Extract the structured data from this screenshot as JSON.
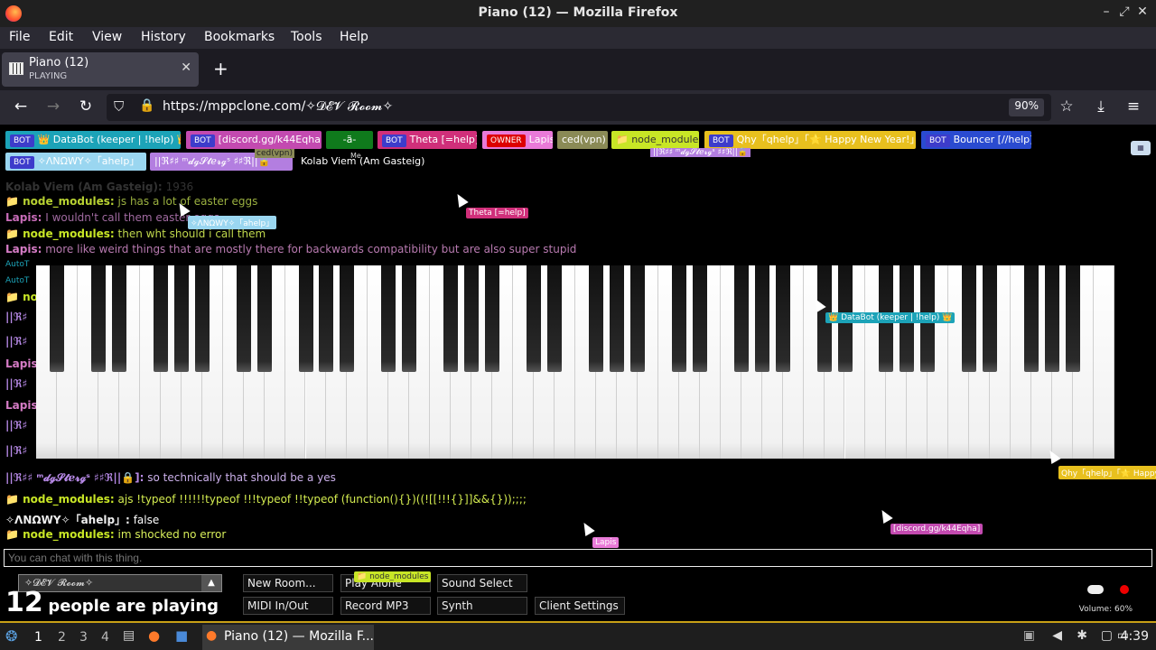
{
  "browser": {
    "window_title": "Piano (12) — Mozilla Firefox",
    "menu": [
      "File",
      "Edit",
      "View",
      "History",
      "Bookmarks",
      "Tools",
      "Help"
    ],
    "tab": {
      "title": "Piano (12)",
      "subtitle": "PLAYING"
    },
    "url": "https://mppclone.com/✧𝓓𝓔𝓥 𝓡𝓸𝓸𝓶✧",
    "zoom": "90%"
  },
  "users": [
    {
      "badge": "BOT",
      "name": "👑 DataBot (keeper | !help) 👑",
      "color": "#1ca3b8",
      "text": "#fff"
    },
    {
      "badge": "BOT",
      "name": "[discord.gg/k44Eqha]",
      "color": "#c34ab0",
      "text": "#fff"
    },
    {
      "badge": "",
      "name": "-ä-",
      "color": "#0f7a1c",
      "text": "#fff"
    },
    {
      "badge": "BOT",
      "name": "Theta [=help]",
      "color": "#d02f7a",
      "text": "#fff"
    },
    {
      "badge": "OWNER",
      "name": "Lapis",
      "color": "#e97ad8",
      "text": "#fff"
    },
    {
      "badge": "",
      "name": "ced(vpn)",
      "color": "#8a8a56",
      "text": "#fff"
    },
    {
      "badge": "",
      "name": "📁 node_modules",
      "color": "#c8e626",
      "text": "#333"
    },
    {
      "badge": "BOT",
      "name": "Qhy「qhelp」「🌟 Happy New Year!」",
      "color": "#e8c01e",
      "text": "#fff"
    },
    {
      "badge": "BOT",
      "name": "Bouncer [//help]",
      "color": "#2a4bd0",
      "text": "#fff"
    },
    {
      "badge": "BOT",
      "name": "✧ΛNΩWY✧「ahelp」",
      "color": "#9ad6f0",
      "text": "#fff"
    },
    {
      "badge": "",
      "name": "||ℜ♯♯ ᵐ𝓭ℊ𝓢𝓽ℯ𝓻ℊˢ ♯♯ℜ||🔒",
      "color": "#b37ee0",
      "text": "#fff"
    },
    {
      "badge": "",
      "name": "Kolab Viem (Am Gasteig)",
      "color": "#000000",
      "text": "#fff"
    }
  ],
  "mini_labels": {
    "ced": "ced(vpn)",
    "me": "Me",
    "mdg": "||ℜ♯♯ ᵐ𝓭ℊ𝓢𝓽ℯ𝓻ℊˢ ♯♯ℜ||🔒"
  },
  "chat": [
    {
      "name": "Kolab Viem (Am Gasteig):",
      "text": "1936",
      "name_color": "#333",
      "text_color": "#333"
    },
    {
      "name": "📁 node_modules:",
      "text": "js has a lot of easter eggs",
      "name_color": "#b8d232",
      "text_color": "#9ab040"
    },
    {
      "name": "Lapis:",
      "text": "I wouldn't call them easter eggs",
      "name_color": "#c86cb8",
      "text_color": "#a06aa0"
    },
    {
      "name": "📁 node_modules:",
      "text": "then wht should i call them",
      "name_color": "#c8e626",
      "text_color": "#c0d84c"
    },
    {
      "name": "Lapis:",
      "text": "more like weird things that are mostly there for backwards compatibility but are also super stupid",
      "name_color": "#d67cc6",
      "text_color": "#b87ab0"
    }
  ],
  "left_stubs": [
    "AutoT",
    "AutoT",
    "📁 no",
    "||ℜ♯",
    "||ℜ♯",
    "Lapis",
    "||ℜ♯",
    "Lapis",
    "||ℜ♯",
    "||ℜ♯"
  ],
  "chat_bottom": [
    {
      "name": "||ℜ♯♯ ᵐ𝓭ℊ𝓢𝓽ℯ𝓻ℊˢ ♯♯ℜ||🔒]:",
      "text": "so technically that should be a yes",
      "name_color": "#b88ae8",
      "text_color": "#cbb0ea"
    },
    {
      "name": "📁 node_modules:",
      "text": "ajs !typeof !!!!!!typeof !!!typeof !!typeof (function(){})((![[!!!{}]]&&{}));;;;",
      "name_color": "#c8e626",
      "text_color": "#d4ec50"
    },
    {
      "name": "✧ΛNΩWY✧「ahelp」:",
      "text": "false",
      "name_color": "#eee",
      "text_color": "#fff"
    },
    {
      "name": "📁 node_modules:",
      "text": "im shocked no error",
      "name_color": "#c8e626",
      "text_color": "#d8ee5a"
    }
  ],
  "cursors": [
    {
      "label": "Theta [=help]",
      "color": "#d02f7a"
    },
    {
      "label": "✧ΛNΩWY✧「ahelp」",
      "color": "#9ad6f0"
    },
    {
      "label": "👑 DataBot (keeper | !help) 👑",
      "color": "#1ca3b8"
    },
    {
      "label": "Qhy「qhelp」「🌟 Happy",
      "color": "#e8c01e"
    },
    {
      "label": "[discord.gg/k44Eqha]",
      "color": "#c34ab0"
    },
    {
      "label": "Lapis",
      "color": "#e97ad8"
    },
    {
      "label": "📁 node_modules",
      "color": "#c8e626"
    }
  ],
  "chat_input": {
    "placeholder": "You can chat with this thing."
  },
  "controls": {
    "room": "✧𝓓𝓔𝓥 𝓡𝓸𝓸𝓶✧",
    "players_count": "12",
    "players_text": "people are playing",
    "buttons": [
      "New Room...",
      "Play Alone",
      "Sound Select",
      "MIDI In/Out",
      "Record MP3",
      "Synth",
      "Client Settings"
    ],
    "volume": "Volume: 60%"
  },
  "taskbar": {
    "workspaces": [
      "1",
      "2",
      "3",
      "4"
    ],
    "app_title": "Piano (12) — Mozilla F...",
    "clock": "4:39"
  },
  "piano": {
    "white_keys": 52
  }
}
